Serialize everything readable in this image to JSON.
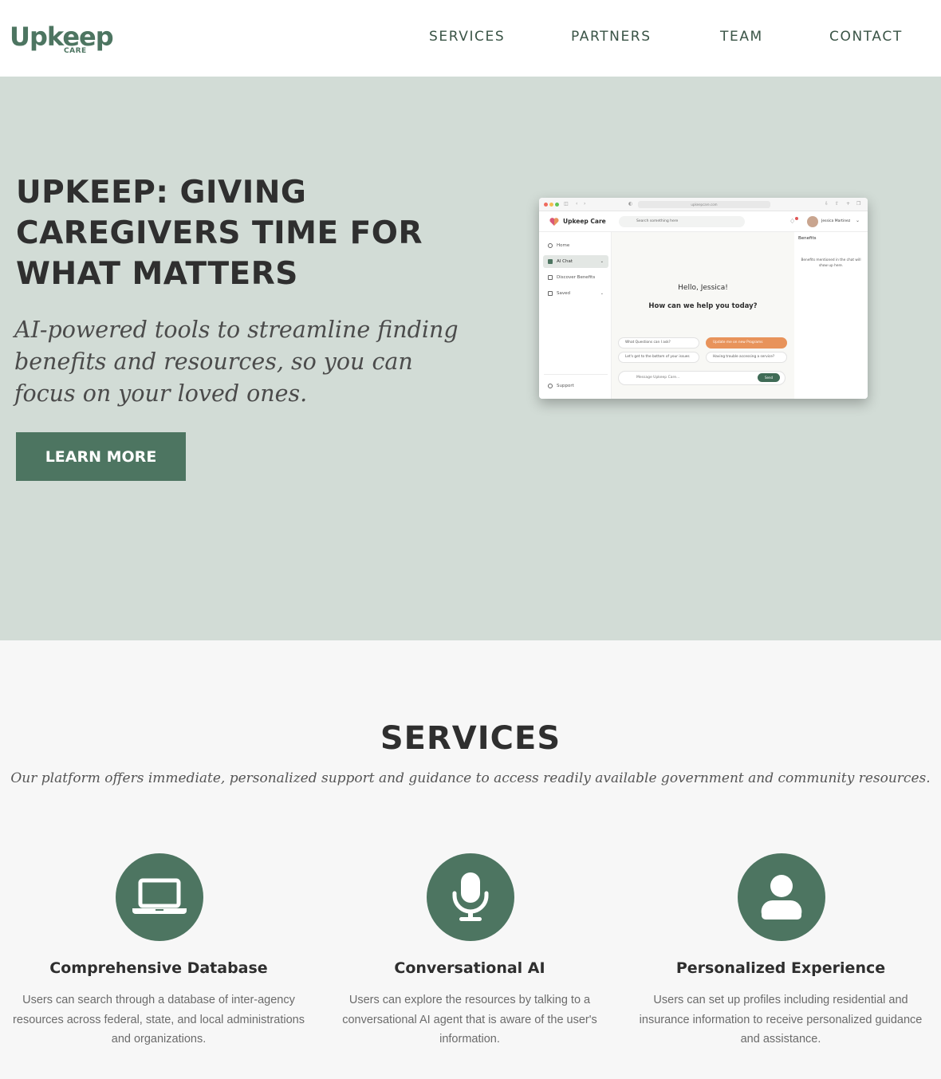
{
  "header": {
    "logo_word": "Upkeep",
    "logo_sub": "CARE",
    "nav": [
      "SERVICES",
      "PARTNERS",
      "TEAM",
      "CONTACT"
    ]
  },
  "hero": {
    "title": "UPKEEP: GIVING CAREGIVERS TIME FOR WHAT MATTERS",
    "subtitle": "AI-powered tools to streamline finding benefits and resources, so you can focus on your loved ones.",
    "cta": "LEARN MORE"
  },
  "mockup": {
    "url": "upkeepcare.com",
    "brand": "Upkeep Care",
    "search_placeholder": "Search something here",
    "user_name": "Jessica Martinez",
    "sidebar": [
      "Home",
      "AI Chat",
      "Discover Benefits",
      "Saved"
    ],
    "support": "Support",
    "greeting": "Hello, Jessica!",
    "prompt": "How can we help you today?",
    "chips": [
      "What Questions can I ask?",
      "Update me on new Programs",
      "Let's get to the bottom of your issues",
      "Having trouble accessing a service?"
    ],
    "message_placeholder": "Message Upkeep Care...",
    "send": "Send",
    "benefits_title": "Benefits",
    "benefits_note": "Benefits mentioned in the chat will show up here."
  },
  "services": {
    "title": "SERVICES",
    "subtitle": "Our platform offers immediate, personalized support and guidance to access readily available government and community resources.",
    "cards": [
      {
        "icon": "laptop-icon",
        "title": "Comprehensive Database",
        "desc": "Users can search through a database of inter-agency resources across federal, state, and local administrations and organizations."
      },
      {
        "icon": "microphone-icon",
        "title": "Conversational AI",
        "desc": "Users can explore the resources by talking to a conversational AI agent that is aware of the user's information."
      },
      {
        "icon": "user-icon",
        "title": "Personalized Experience",
        "desc": "Users can set up profiles including residential and insurance information to receive personalized guidance and assistance."
      }
    ]
  },
  "colors": {
    "accent": "#4d7561",
    "hero_bg": "#d2dcd6",
    "services_bg": "#f7f7f7",
    "chip_orange": "#e8935b"
  }
}
